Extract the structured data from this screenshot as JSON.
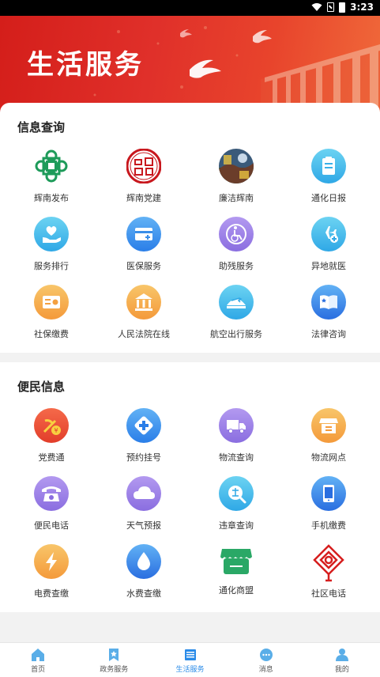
{
  "status_bar": {
    "time": "3:23"
  },
  "banner": {
    "title": "生活服务"
  },
  "sections": [
    {
      "title": "信息查询",
      "items": [
        {
          "label": "辉南发布",
          "icon": "huinan-release-logo-icon"
        },
        {
          "label": "辉南党建",
          "icon": "huinan-party-building-seal-icon"
        },
        {
          "label": "廉洁辉南",
          "icon": "clean-huinan-badge-icon"
        },
        {
          "label": "通化日报",
          "icon": "newspaper-icon"
        },
        {
          "label": "服务排行",
          "icon": "heart-hand-icon"
        },
        {
          "label": "医保服务",
          "icon": "medical-card-icon"
        },
        {
          "label": "助残服务",
          "icon": "wheelchair-icon"
        },
        {
          "label": "异地就医",
          "icon": "airplane-medical-icon"
        },
        {
          "label": "社保缴费",
          "icon": "id-card-icon"
        },
        {
          "label": "人民法院在线",
          "icon": "courthouse-icon"
        },
        {
          "label": "航空出行服务",
          "icon": "airport-icon"
        },
        {
          "label": "法律咨询",
          "icon": "law-book-icon"
        }
      ]
    },
    {
      "title": "便民信息",
      "items": [
        {
          "label": "党费通",
          "icon": "party-emblem-icon"
        },
        {
          "label": "预约挂号",
          "icon": "medical-cross-icon"
        },
        {
          "label": "物流查询",
          "icon": "truck-icon"
        },
        {
          "label": "物流网点",
          "icon": "store-icon"
        },
        {
          "label": "便民电话",
          "icon": "telephone-icon"
        },
        {
          "label": "天气预报",
          "icon": "cloud-icon"
        },
        {
          "label": "违章查询",
          "icon": "violation-search-icon"
        },
        {
          "label": "手机缴费",
          "icon": "mobile-phone-icon"
        },
        {
          "label": "电费查缴",
          "icon": "lightning-icon"
        },
        {
          "label": "水费查缴",
          "icon": "water-drop-icon"
        },
        {
          "label": "通化商盟",
          "icon": "shop-awning-icon"
        },
        {
          "label": "社区电话",
          "icon": "chinese-knot-icon"
        }
      ]
    }
  ],
  "bottom_nav": {
    "items": [
      {
        "label": "首页",
        "icon": "home-icon"
      },
      {
        "label": "政务服务",
        "icon": "bookmark-star-icon"
      },
      {
        "label": "生活服务",
        "icon": "life-service-icon",
        "active": true
      },
      {
        "label": "消息",
        "icon": "chat-bubble-icon"
      },
      {
        "label": "我的",
        "icon": "person-icon"
      }
    ]
  },
  "colors": {
    "banner_red": "#d41e1a",
    "nav_active": "#2a8be8",
    "party_red": "#e23d2a",
    "green": "#1e9b5a"
  }
}
